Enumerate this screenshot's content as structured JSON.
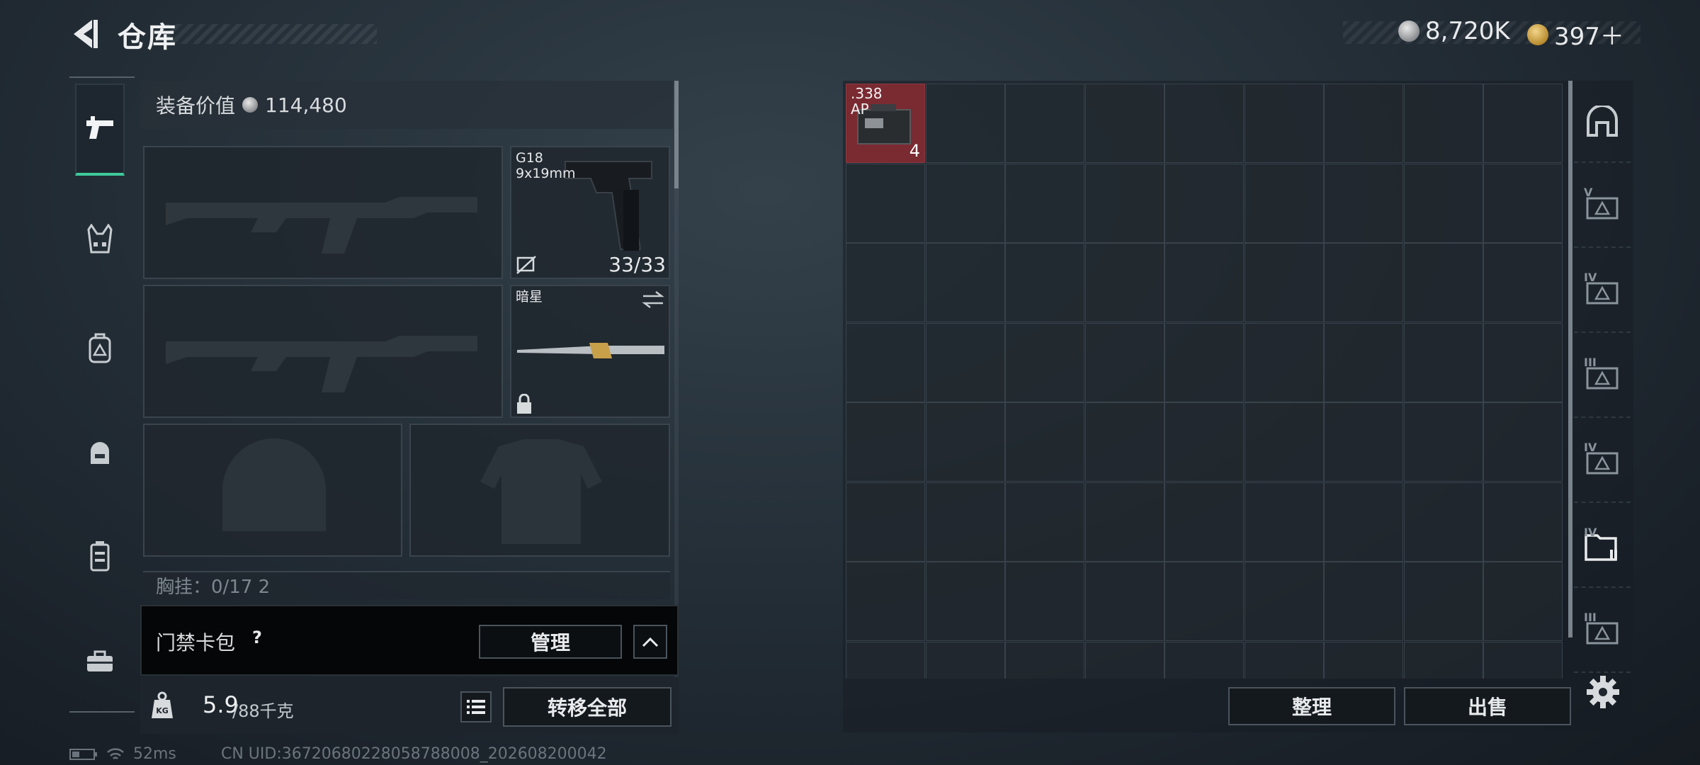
{
  "header": {
    "title": "仓库",
    "currencies": [
      {
        "icon": "silver-coin-icon",
        "value": "8,720K"
      },
      {
        "icon": "gold-triangle-coin-icon",
        "value": "397＋"
      }
    ]
  },
  "left_tabs": [
    {
      "icon": "pistol-icon",
      "active": true
    },
    {
      "icon": "vest-icon",
      "active": false
    },
    {
      "icon": "backpack-icon",
      "active": false
    },
    {
      "icon": "helmet-backpack-icon",
      "active": false
    },
    {
      "icon": "case-icon",
      "active": false
    },
    {
      "icon": "toolbox-icon",
      "active": false
    }
  ],
  "equipment": {
    "value_label": "装备价值",
    "value": "114,480",
    "pistol": {
      "name": "G18",
      "caliber": "9x19mm",
      "ammo": "33/33"
    },
    "melee": {
      "name": "暗星"
    },
    "chest_row_text": "胸挂：0/17  2"
  },
  "keycard": {
    "label": "门禁卡包",
    "help": "?",
    "manage_label": "管理"
  },
  "weight": {
    "unit_icon": "KG",
    "current": "5.9",
    "max": "/88千克",
    "transfer_all_label": "转移全部"
  },
  "storage": {
    "item": {
      "name": ".338\nAP",
      "count": "4"
    },
    "sort_label": "整理",
    "sell_label": "出售",
    "side_tabs": [
      {
        "icon": "bunker-icon",
        "num": ""
      },
      {
        "icon": "weapon-case-icon",
        "num": "V"
      },
      {
        "icon": "medical-case-icon",
        "num": "IV"
      },
      {
        "icon": "warning-case-icon",
        "num": "III"
      },
      {
        "icon": "shield-case-icon",
        "num": "IV"
      },
      {
        "icon": "folder-case-icon",
        "num": "IV"
      },
      {
        "icon": "warning-case-icon",
        "num": "III"
      }
    ]
  },
  "status": {
    "ping": "52ms",
    "uid": "CN UID:367206802280587880​08_202608200042"
  }
}
